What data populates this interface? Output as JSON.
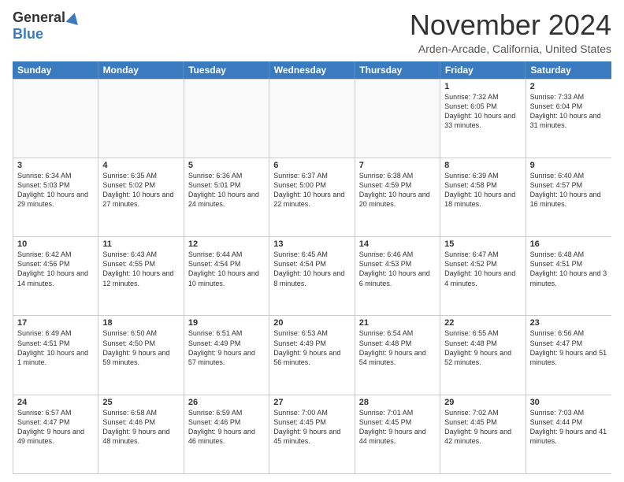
{
  "header": {
    "logo_general": "General",
    "logo_blue": "Blue",
    "month_title": "November 2024",
    "location": "Arden-Arcade, California, United States"
  },
  "calendar": {
    "days": [
      "Sunday",
      "Monday",
      "Tuesday",
      "Wednesday",
      "Thursday",
      "Friday",
      "Saturday"
    ],
    "rows": [
      [
        {
          "day": "",
          "text": ""
        },
        {
          "day": "",
          "text": ""
        },
        {
          "day": "",
          "text": ""
        },
        {
          "day": "",
          "text": ""
        },
        {
          "day": "",
          "text": ""
        },
        {
          "day": "1",
          "text": "Sunrise: 7:32 AM\nSunset: 6:05 PM\nDaylight: 10 hours and 33 minutes."
        },
        {
          "day": "2",
          "text": "Sunrise: 7:33 AM\nSunset: 6:04 PM\nDaylight: 10 hours and 31 minutes."
        }
      ],
      [
        {
          "day": "3",
          "text": "Sunrise: 6:34 AM\nSunset: 5:03 PM\nDaylight: 10 hours and 29 minutes."
        },
        {
          "day": "4",
          "text": "Sunrise: 6:35 AM\nSunset: 5:02 PM\nDaylight: 10 hours and 27 minutes."
        },
        {
          "day": "5",
          "text": "Sunrise: 6:36 AM\nSunset: 5:01 PM\nDaylight: 10 hours and 24 minutes."
        },
        {
          "day": "6",
          "text": "Sunrise: 6:37 AM\nSunset: 5:00 PM\nDaylight: 10 hours and 22 minutes."
        },
        {
          "day": "7",
          "text": "Sunrise: 6:38 AM\nSunset: 4:59 PM\nDaylight: 10 hours and 20 minutes."
        },
        {
          "day": "8",
          "text": "Sunrise: 6:39 AM\nSunset: 4:58 PM\nDaylight: 10 hours and 18 minutes."
        },
        {
          "day": "9",
          "text": "Sunrise: 6:40 AM\nSunset: 4:57 PM\nDaylight: 10 hours and 16 minutes."
        }
      ],
      [
        {
          "day": "10",
          "text": "Sunrise: 6:42 AM\nSunset: 4:56 PM\nDaylight: 10 hours and 14 minutes."
        },
        {
          "day": "11",
          "text": "Sunrise: 6:43 AM\nSunset: 4:55 PM\nDaylight: 10 hours and 12 minutes."
        },
        {
          "day": "12",
          "text": "Sunrise: 6:44 AM\nSunset: 4:54 PM\nDaylight: 10 hours and 10 minutes."
        },
        {
          "day": "13",
          "text": "Sunrise: 6:45 AM\nSunset: 4:54 PM\nDaylight: 10 hours and 8 minutes."
        },
        {
          "day": "14",
          "text": "Sunrise: 6:46 AM\nSunset: 4:53 PM\nDaylight: 10 hours and 6 minutes."
        },
        {
          "day": "15",
          "text": "Sunrise: 6:47 AM\nSunset: 4:52 PM\nDaylight: 10 hours and 4 minutes."
        },
        {
          "day": "16",
          "text": "Sunrise: 6:48 AM\nSunset: 4:51 PM\nDaylight: 10 hours and 3 minutes."
        }
      ],
      [
        {
          "day": "17",
          "text": "Sunrise: 6:49 AM\nSunset: 4:51 PM\nDaylight: 10 hours and 1 minute."
        },
        {
          "day": "18",
          "text": "Sunrise: 6:50 AM\nSunset: 4:50 PM\nDaylight: 9 hours and 59 minutes."
        },
        {
          "day": "19",
          "text": "Sunrise: 6:51 AM\nSunset: 4:49 PM\nDaylight: 9 hours and 57 minutes."
        },
        {
          "day": "20",
          "text": "Sunrise: 6:53 AM\nSunset: 4:49 PM\nDaylight: 9 hours and 56 minutes."
        },
        {
          "day": "21",
          "text": "Sunrise: 6:54 AM\nSunset: 4:48 PM\nDaylight: 9 hours and 54 minutes."
        },
        {
          "day": "22",
          "text": "Sunrise: 6:55 AM\nSunset: 4:48 PM\nDaylight: 9 hours and 52 minutes."
        },
        {
          "day": "23",
          "text": "Sunrise: 6:56 AM\nSunset: 4:47 PM\nDaylight: 9 hours and 51 minutes."
        }
      ],
      [
        {
          "day": "24",
          "text": "Sunrise: 6:57 AM\nSunset: 4:47 PM\nDaylight: 9 hours and 49 minutes."
        },
        {
          "day": "25",
          "text": "Sunrise: 6:58 AM\nSunset: 4:46 PM\nDaylight: 9 hours and 48 minutes."
        },
        {
          "day": "26",
          "text": "Sunrise: 6:59 AM\nSunset: 4:46 PM\nDaylight: 9 hours and 46 minutes."
        },
        {
          "day": "27",
          "text": "Sunrise: 7:00 AM\nSunset: 4:45 PM\nDaylight: 9 hours and 45 minutes."
        },
        {
          "day": "28",
          "text": "Sunrise: 7:01 AM\nSunset: 4:45 PM\nDaylight: 9 hours and 44 minutes."
        },
        {
          "day": "29",
          "text": "Sunrise: 7:02 AM\nSunset: 4:45 PM\nDaylight: 9 hours and 42 minutes."
        },
        {
          "day": "30",
          "text": "Sunrise: 7:03 AM\nSunset: 4:44 PM\nDaylight: 9 hours and 41 minutes."
        }
      ]
    ]
  }
}
